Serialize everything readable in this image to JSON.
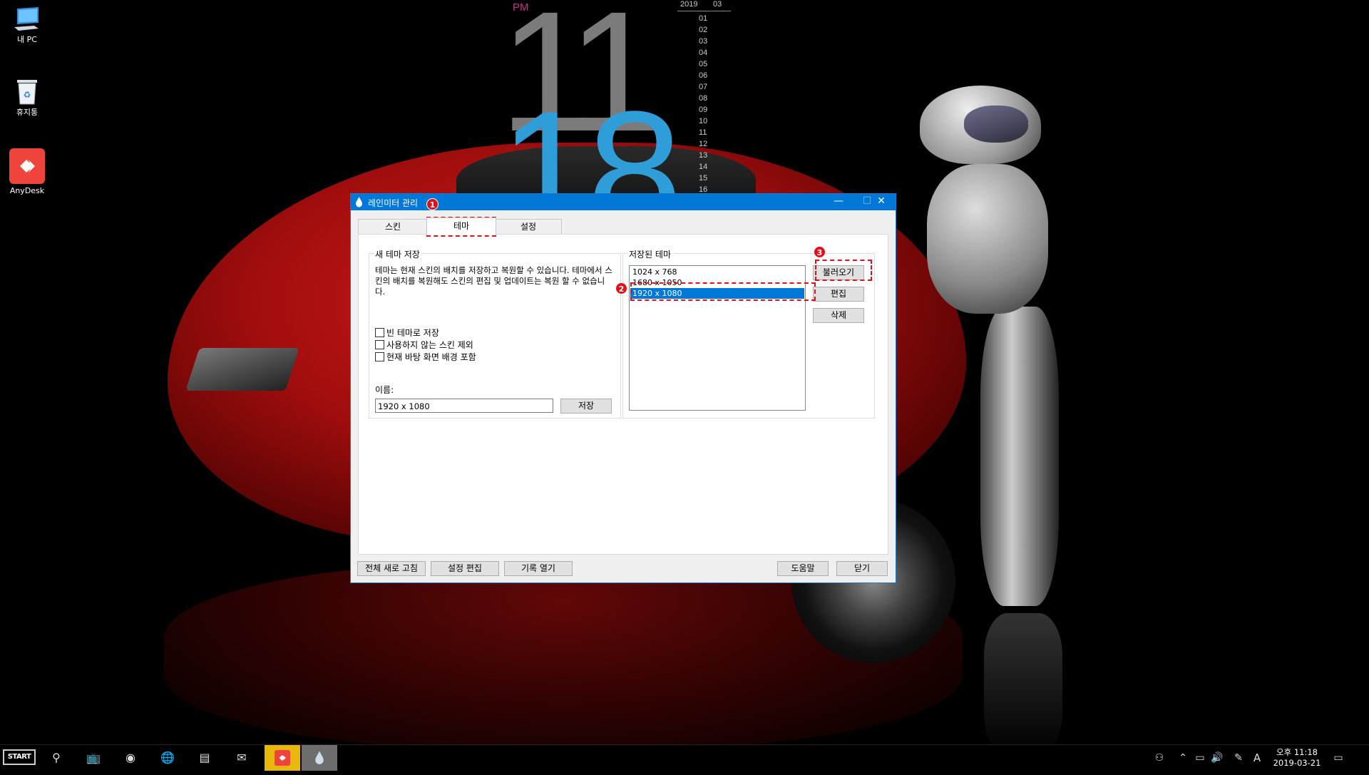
{
  "desktop": {
    "icons": [
      {
        "label": "내 PC"
      },
      {
        "label": "휴지통"
      },
      {
        "label": "AnyDesk"
      }
    ]
  },
  "clock": {
    "ampm": "PM",
    "hour": "11",
    "minute": "18",
    "year": "2019",
    "month": "03",
    "days": [
      "01",
      "02",
      "03",
      "04",
      "05",
      "06",
      "07",
      "08",
      "09",
      "10",
      "11",
      "12",
      "13",
      "14",
      "15",
      "16"
    ]
  },
  "window": {
    "title": "레인미터 관리",
    "tabs": [
      {
        "label": "스킨"
      },
      {
        "label": "테마"
      },
      {
        "label": "설정"
      }
    ],
    "new_theme": {
      "group_title": "새 테마 저장",
      "description": "테마는 현재 스킨의 배치를 저장하고 복원할 수 있습니다. 테마에서 스킨의 배치를 복원해도 스킨의 편집 및 업데이트는 복원 할 수 없습니다.",
      "checkboxes": [
        {
          "label": "빈 테마로 저장",
          "checked": false
        },
        {
          "label": "사용하지 않는 스킨 제외",
          "checked": false
        },
        {
          "label": "현재 바탕 화면 배경 포함",
          "checked": false
        }
      ],
      "name_label": "이름:",
      "name_value": "1920 x 1080",
      "save_label": "저장"
    },
    "saved_themes": {
      "group_title": "저장된 테마",
      "items": [
        {
          "label": "1024 x 768",
          "selected": false
        },
        {
          "label": "1680 x 1050",
          "selected": false
        },
        {
          "label": "1920 x 1080",
          "selected": true
        }
      ],
      "load_label": "불러오기",
      "edit_label": "편집",
      "delete_label": "삭제"
    },
    "bottom_buttons": {
      "refresh_all": "전체 새로 고침",
      "edit_settings": "설정 편집",
      "open_log": "기록 열기",
      "help": "도움말",
      "close": "닫기"
    }
  },
  "annotations": [
    "1",
    "2",
    "3"
  ],
  "taskbar": {
    "start_label": "START",
    "tray": {
      "ime": "A",
      "time": "오후 11:18",
      "date": "2019-03-21"
    }
  },
  "colors": {
    "titlebar": "#0078d7",
    "selection": "#0078d7",
    "annotation": "#e0101a",
    "clock_hour": "#7b7b7b",
    "clock_minute": "#2f9ed8",
    "clock_ampm": "#d42c8e"
  }
}
